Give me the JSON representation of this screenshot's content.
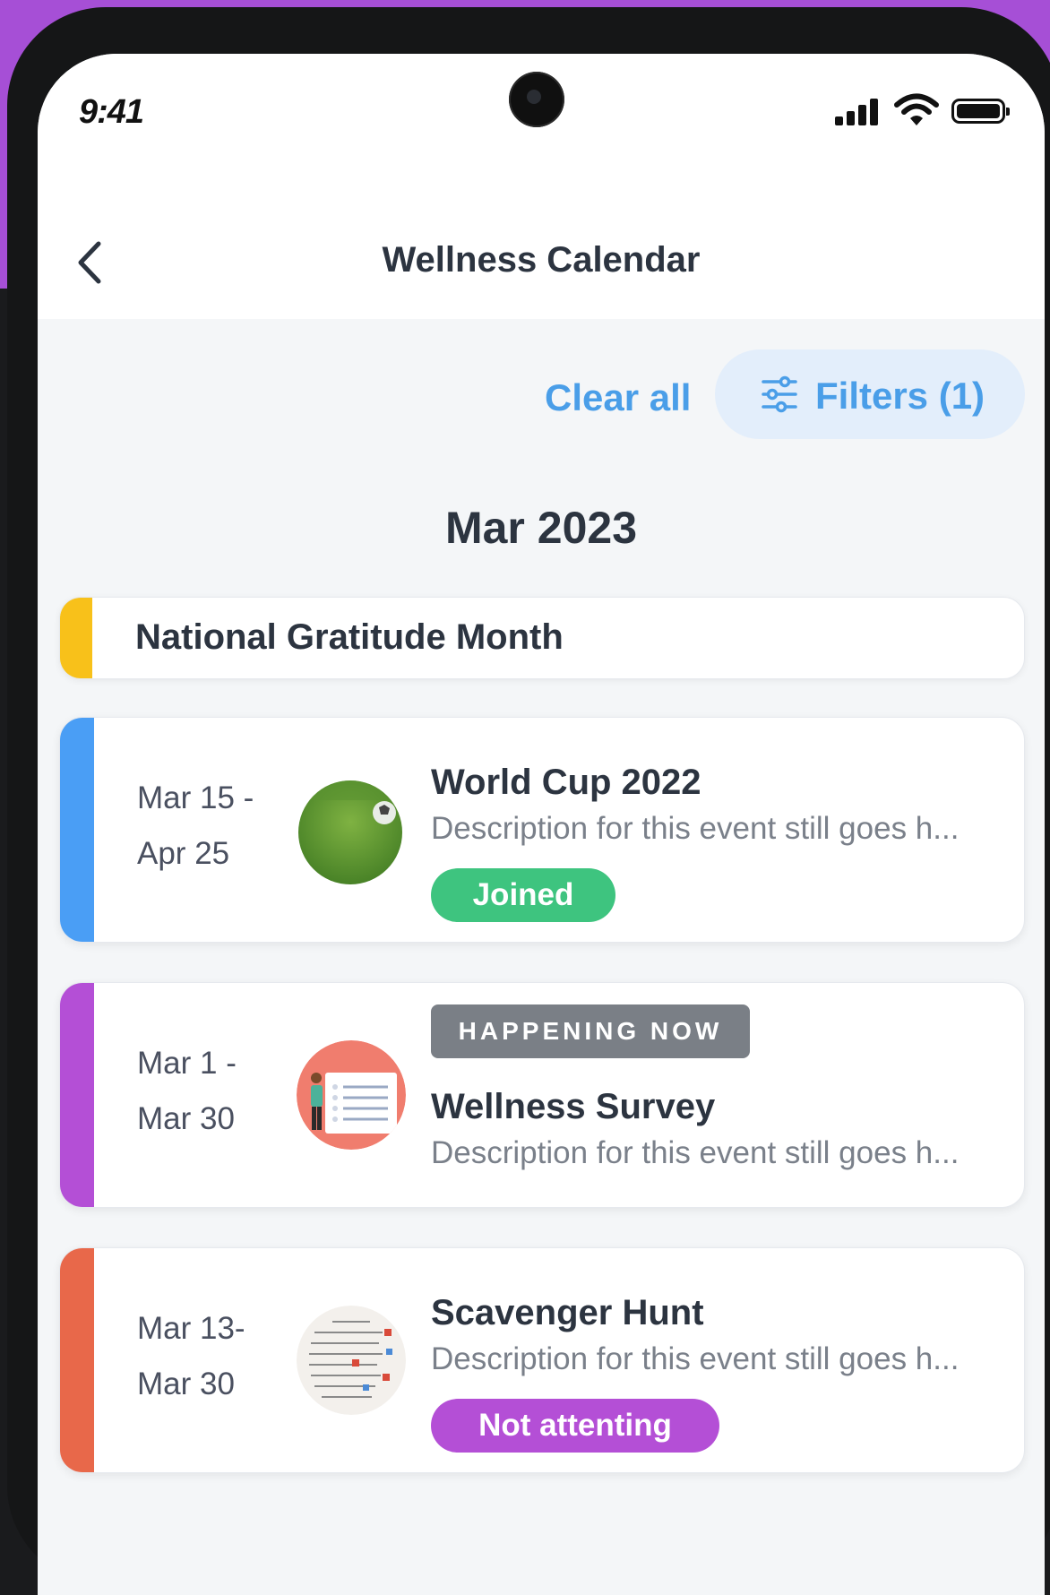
{
  "status_bar": {
    "time": "9:41"
  },
  "header": {
    "title": "Wellness Calendar"
  },
  "toolbar": {
    "clear_all": "Clear all",
    "filters": "Filters (1)"
  },
  "month": "Mar 2023",
  "banner": {
    "title": "National Gratitude Month",
    "color": "#f8c11a"
  },
  "events": [
    {
      "date_line1": "Mar 15 -",
      "date_line2": "Apr 25",
      "title": "World Cup 2022",
      "description": "Description for this event still goes h...",
      "status": "Joined",
      "accent": "#4a9ef5",
      "status_color": "#3ec47f",
      "image": "soccer-ball-on-grass"
    },
    {
      "date_line1": "Mar 1 -",
      "date_line2": "Mar 30",
      "tag": "HAPPENING NOW",
      "title": "Wellness Survey",
      "description": "Description for this event still goes h...",
      "accent": "#b44fd6",
      "image": "survey-illustration"
    },
    {
      "date_line1": "Mar 13-",
      "date_line2": "Mar 30",
      "title": "Scavenger Hunt",
      "description": "Description for this event still goes h...",
      "status": "Not attenting",
      "accent": "#e8684a",
      "status_color": "#b44fd6",
      "image": "scavenger-list"
    }
  ]
}
